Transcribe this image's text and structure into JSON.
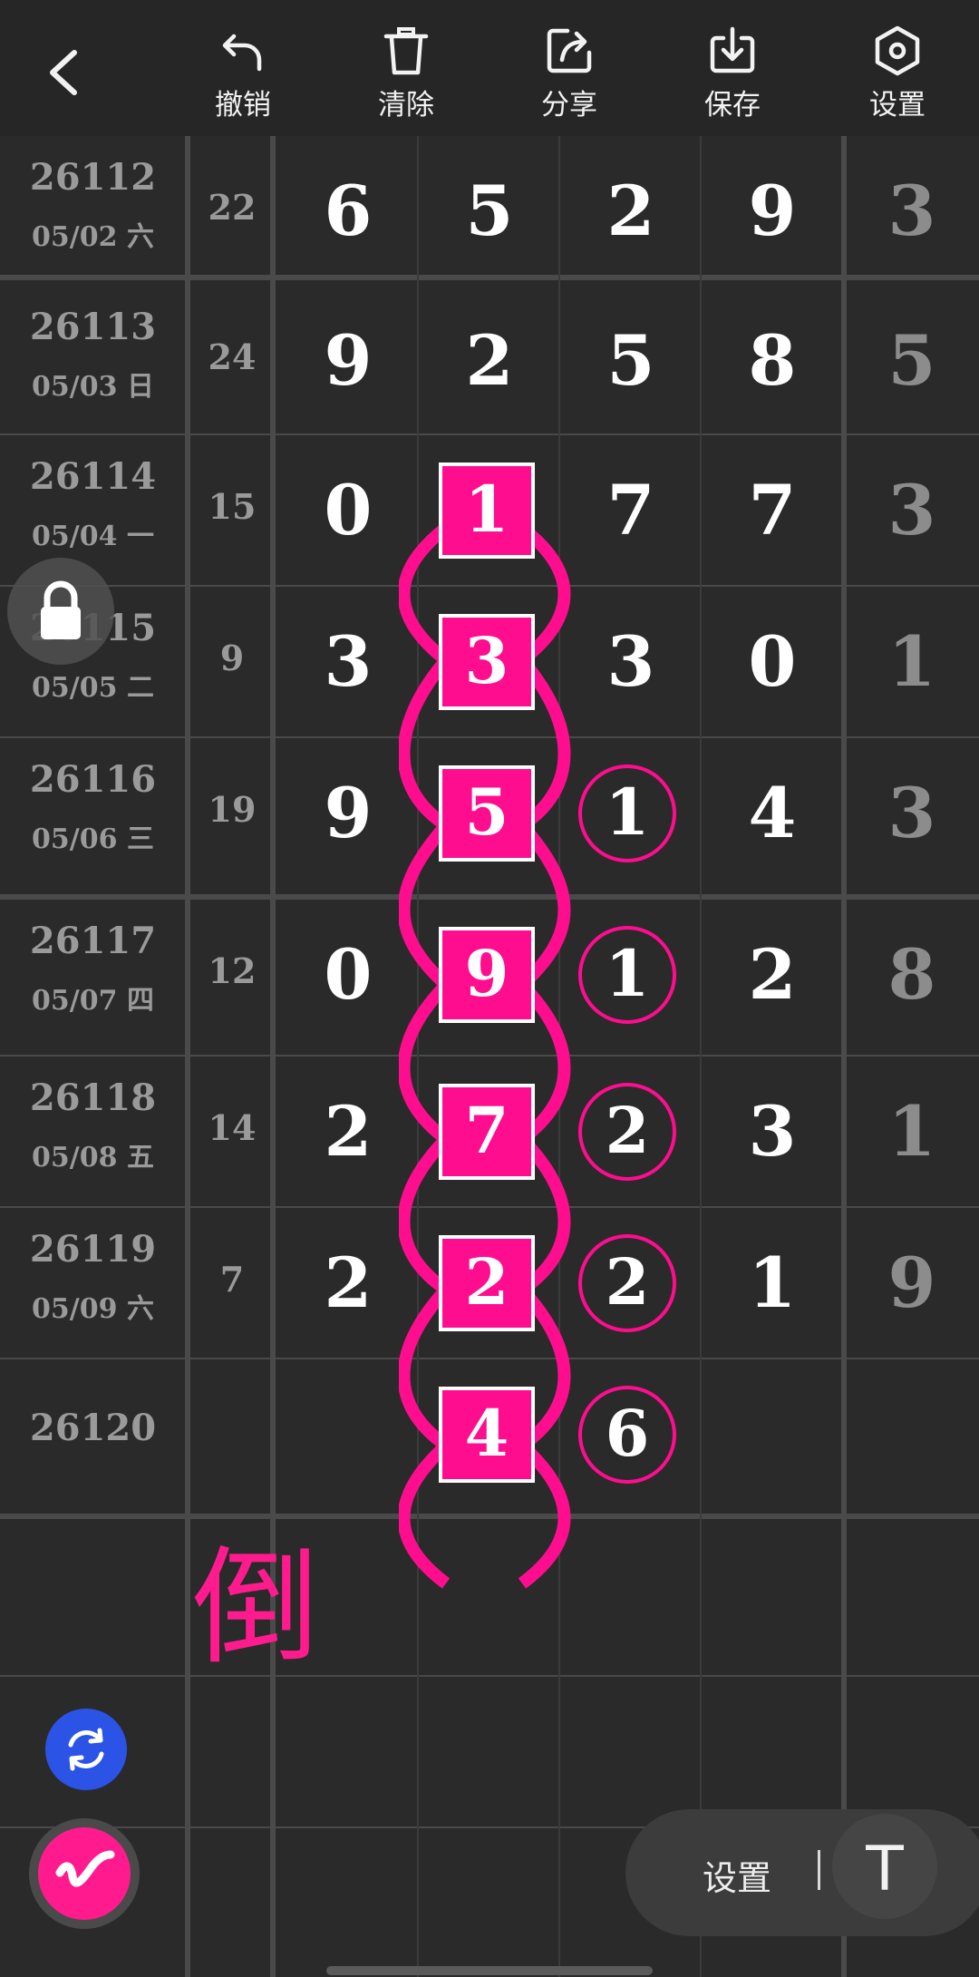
{
  "toolbar": {
    "back_icon": "chevron-left-icon",
    "undo_label": "撤销",
    "clear_label": "清除",
    "share_label": "分享",
    "save_label": "保存",
    "settings_label": "设置"
  },
  "rows": [
    {
      "issue": "26112",
      "date": "05/02 六",
      "sum": "22",
      "d": [
        "6",
        "5",
        "2",
        "9",
        "3"
      ]
    },
    {
      "issue": "26113",
      "date": "05/03 日",
      "sum": "24",
      "d": [
        "9",
        "2",
        "5",
        "8",
        "5"
      ]
    },
    {
      "issue": "26114",
      "date": "05/04 一",
      "sum": "15",
      "d": [
        "0",
        "1",
        "7",
        "7",
        "3"
      ]
    },
    {
      "issue": "26115",
      "date": "05/05 二",
      "sum": "9",
      "d": [
        "3",
        "3",
        "3",
        "0",
        "1"
      ]
    },
    {
      "issue": "26116",
      "date": "05/06 三",
      "sum": "19",
      "d": [
        "9",
        "5",
        "1",
        "4",
        "3"
      ]
    },
    {
      "issue": "26117",
      "date": "05/07 四",
      "sum": "12",
      "d": [
        "0",
        "9",
        "1",
        "2",
        "8"
      ]
    },
    {
      "issue": "26118",
      "date": "05/08 五",
      "sum": "14",
      "d": [
        "2",
        "7",
        "2",
        "3",
        "1"
      ]
    },
    {
      "issue": "26119",
      "date": "05/09 六",
      "sum": "7",
      "d": [
        "2",
        "2",
        "2",
        "1",
        "9"
      ]
    },
    {
      "issue": "26120",
      "date": "",
      "sum": "",
      "d": [
        "",
        "4",
        "6",
        "",
        ""
      ]
    }
  ],
  "annotation_char": "倒",
  "bottom": {
    "settings_label": "设置",
    "text_tool_label": "T"
  },
  "colors": {
    "accent": "#ff0d8f",
    "background": "#2a2a2a",
    "grid": "#4a4a4a",
    "sync": "#2b54e6"
  }
}
